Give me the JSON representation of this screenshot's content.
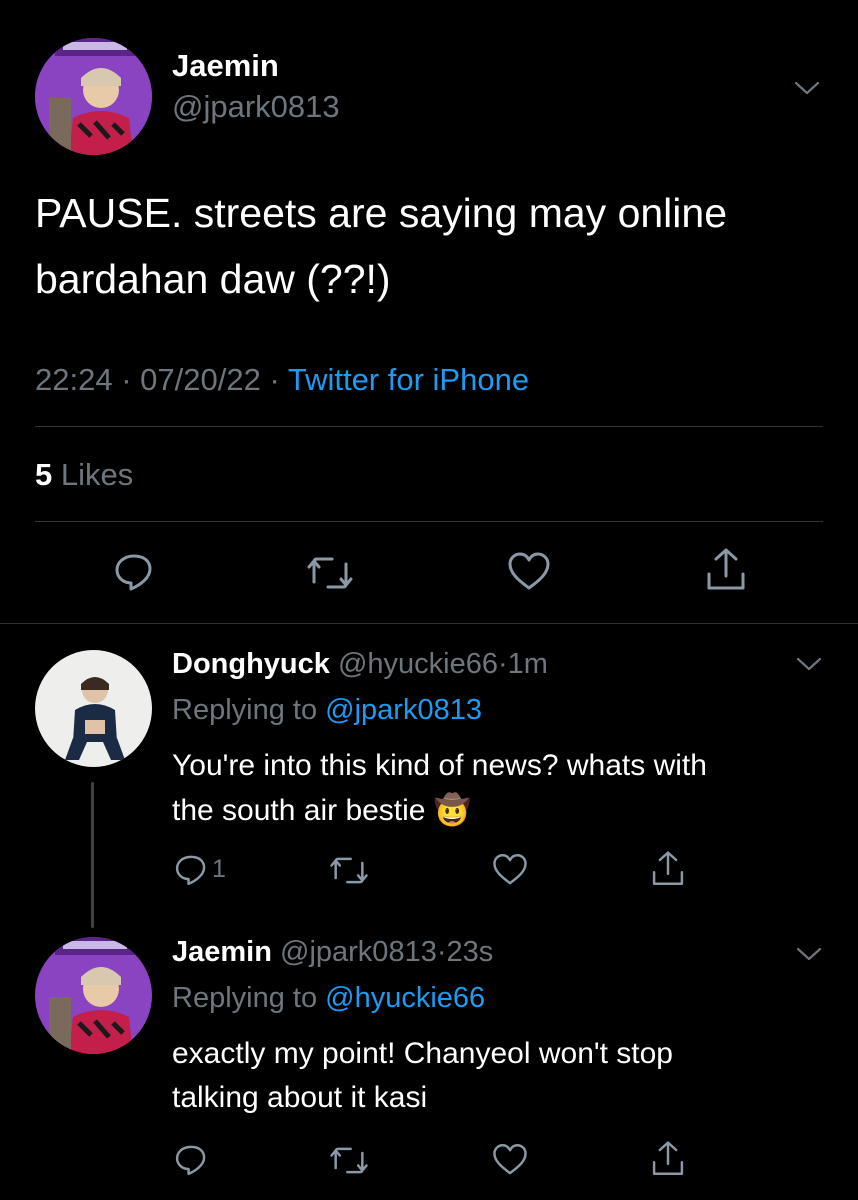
{
  "main_tweet": {
    "name": "Jaemin",
    "handle": "@jpark0813",
    "text_line1": "PAUSE. streets are saying may online",
    "text_line2": "bardahan daw (??!)",
    "time": "22:24",
    "dot1": "·",
    "date": "07/20/22",
    "dot2": "·",
    "source": "Twitter for iPhone",
    "likes_count": "5",
    "likes_label": "Likes"
  },
  "reply1": {
    "name": "Donghyuck",
    "handle": "@hyuckie66",
    "dot": "·",
    "age": "1m",
    "replying_label": "Replying to",
    "replying_handle": "@jpark0813",
    "text_line1": "You're into this kind of news? whats with",
    "text_line2": "the south air bestie",
    "emoji": "🤠",
    "reply_count": "1"
  },
  "reply2": {
    "name": "Jaemin",
    "handle": "@jpark0813",
    "dot": "·",
    "age": "23s",
    "replying_label": "Replying to",
    "replying_handle": "@hyuckie66",
    "text_line1": "exactly my point! Chanyeol won't stop",
    "text_line2": "talking about it kasi"
  },
  "icons": {
    "reply": "reply-icon",
    "retweet": "retweet-icon",
    "like": "heart-icon",
    "share": "share-icon",
    "more": "chevron-down-icon"
  },
  "colors": {
    "background": "#000000",
    "muted": "#6e767d",
    "link": "#1d9bf0",
    "divider": "#2f3336"
  }
}
